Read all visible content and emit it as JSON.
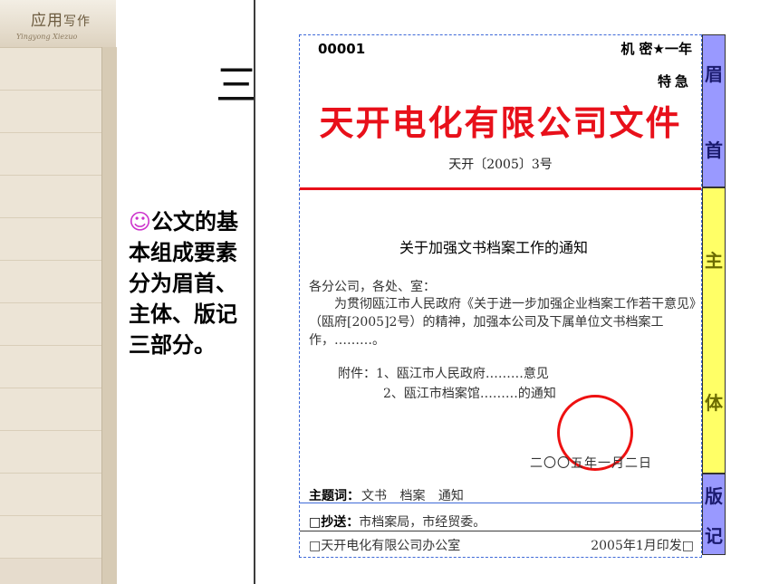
{
  "logo": {
    "text_main": "应用",
    "text_small": "写作",
    "text_sub": "Yingyong Xiezuo"
  },
  "slide": {
    "title_visible": "三",
    "smiley": "☺",
    "bullet_text": "公文的基本组成要素分为眉首、主体、版记三部分。"
  },
  "document": {
    "serial": "00001",
    "secret": "机 密★一年",
    "urgent": "特急",
    "issuer": "天开电化有限公司文件",
    "doc_number": "天开〔2005〕3号",
    "title": "关于加强文书档案工作的通知",
    "addressee": "各分公司，各处、室：",
    "body": "为贯彻瓯江市人民政府《关于进一步加强企业档案工作若干意见》（瓯府[2005]2号）的精神，加强本公司及下属单位文书档案工作，………。",
    "attachment_1": "附件：1、瓯江市人民政府………意见",
    "attachment_2": "2、瓯江市档案馆………的通知",
    "date": "二〇〇五年一月二日",
    "subject_label": "主题词：",
    "subject_value": "文书 档案 通知",
    "cc_label": "□抄送：",
    "cc_value": "市档案局，市经贸委。",
    "printer": "□天开电化有限公司办公室",
    "print_date": "2005年1月印发□"
  },
  "sections": {
    "head": [
      "眉",
      "首"
    ],
    "main": [
      "主",
      "体"
    ],
    "foot": [
      "版",
      "记"
    ]
  },
  "colors": {
    "red": "#e8101a",
    "head_bar": "#9999ff",
    "main_bar": "#ffff66",
    "smiley": "#cc33cc"
  }
}
